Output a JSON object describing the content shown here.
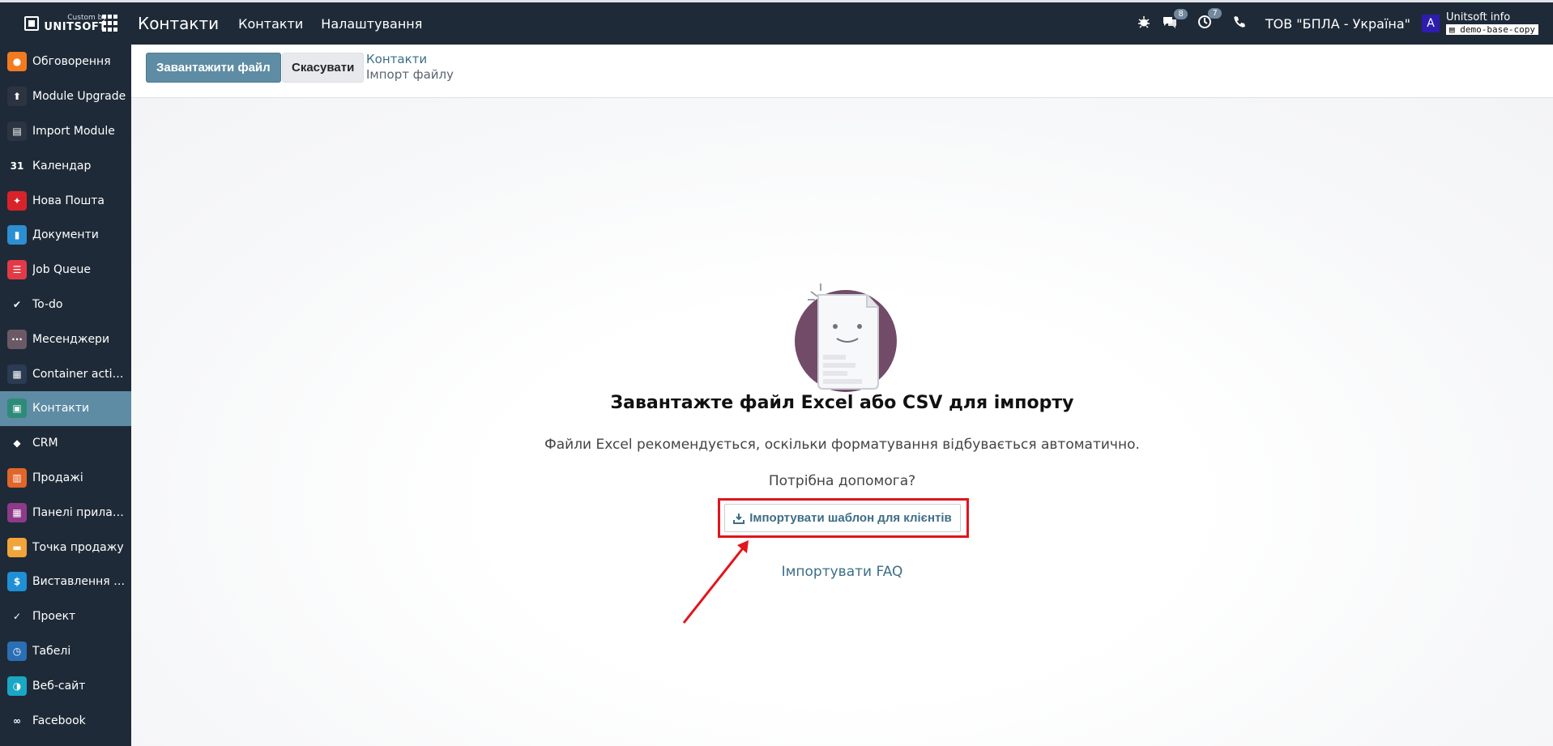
{
  "topbar": {
    "brand_small": "Custom by",
    "brand_big": "UNITSOFT",
    "app_title": "Контакти",
    "menu": [
      "Контакти",
      "Налаштування"
    ],
    "messages_count": "8",
    "activities_count": "7",
    "company": "ТОВ \"БПЛА - Україна\"",
    "avatar_letter": "A",
    "user_name": "Unitsoft info",
    "db_name": "demo-base-copy"
  },
  "sidebar": {
    "items": [
      {
        "label": "Обговорення",
        "icon": "discuss-icon",
        "color": "#f47a1f"
      },
      {
        "label": "Module Upgrade",
        "icon": "upgrade-icon",
        "color": "#2b3440"
      },
      {
        "label": "Import Module",
        "icon": "import-module-icon",
        "color": "#2b3440"
      },
      {
        "label": "Календар",
        "icon": "calendar-icon",
        "color": "#1f2a38"
      },
      {
        "label": "Нова Пошта",
        "icon": "nova-poshta-icon",
        "color": "#d8232a"
      },
      {
        "label": "Документи",
        "icon": "documents-icon",
        "color": "#2b8fd1"
      },
      {
        "label": "Job Queue",
        "icon": "job-queue-icon",
        "color": "#e23a48"
      },
      {
        "label": "To-do",
        "icon": "todo-icon",
        "color": "#1f2a38"
      },
      {
        "label": "Месенджери",
        "icon": "messengers-icon",
        "color": "#6b5a66"
      },
      {
        "label": "Container actions",
        "icon": "container-icon",
        "color": "#2a3b52"
      },
      {
        "label": "Контакти",
        "icon": "contacts-icon",
        "color": "#2e8b7a"
      },
      {
        "label": "CRM",
        "icon": "crm-icon",
        "color": "#1f2a38"
      },
      {
        "label": "Продажі",
        "icon": "sales-icon",
        "color": "#e0662a"
      },
      {
        "label": "Панелі приладів",
        "icon": "dashboards-icon",
        "color": "#8e3a8a"
      },
      {
        "label": "Точка продажу",
        "icon": "pos-icon",
        "color": "#f0a43a"
      },
      {
        "label": "Виставлення ра...",
        "icon": "invoicing-icon",
        "color": "#1f8fd6"
      },
      {
        "label": "Проект",
        "icon": "project-icon",
        "color": "#1f2a38"
      },
      {
        "label": "Табелі",
        "icon": "timesheet-icon",
        "color": "#2a6fb5"
      },
      {
        "label": "Веб-сайт",
        "icon": "website-icon",
        "color": "#1aa7c6"
      },
      {
        "label": "Facebook",
        "icon": "facebook-icon",
        "color": "#1f2a38"
      }
    ],
    "active_index": 10
  },
  "control": {
    "upload_label": "Завантажити файл",
    "cancel_label": "Скасувати",
    "breadcrumb_parent": "Контакти",
    "breadcrumb_current": "Імпорт файлу"
  },
  "main": {
    "title": "Завантажте файл Excel або CSV для імпорту",
    "text": "Файли Excel рекомендується, оскільки форматування відбувається автоматично.",
    "help_question": "Потрібна допомога?",
    "template_button": "Імпортувати шаблон для клієнтів",
    "faq_link": "Імпортувати FAQ",
    "highlight_color": "#e3141c"
  }
}
